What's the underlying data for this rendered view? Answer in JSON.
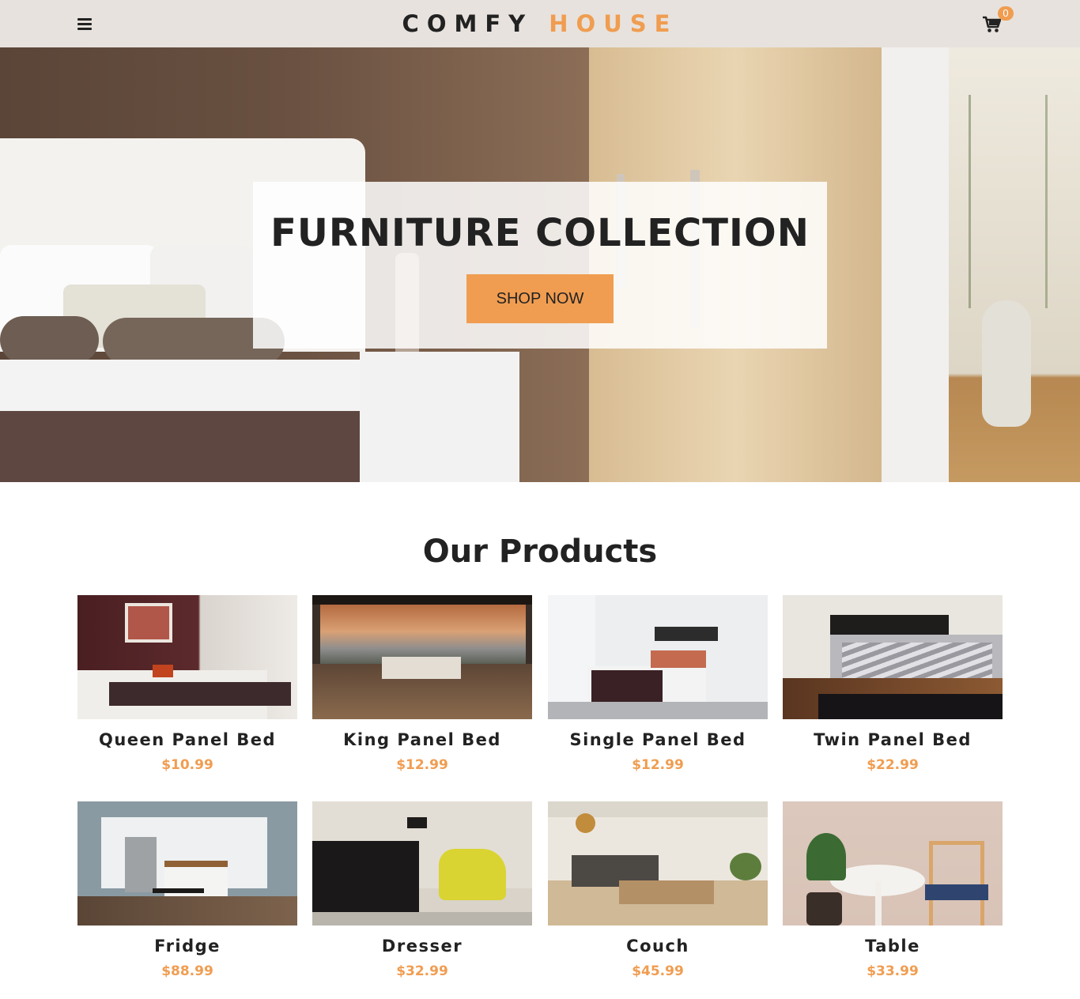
{
  "navbar": {
    "brand_first": "COMFY",
    "brand_second": "HOUSE",
    "cart_count": "0",
    "menu_icon": "bars-icon",
    "cart_icon": "cart-icon"
  },
  "hero": {
    "title": "FURNITURE COLLECTION",
    "button_label": "SHOP NOW"
  },
  "products": {
    "title": "Our Products",
    "items": [
      {
        "name": "Queen Panel Bed",
        "price": "$10.99"
      },
      {
        "name": "King Panel Bed",
        "price": "$12.99"
      },
      {
        "name": "Single Panel Bed",
        "price": "$12.99"
      },
      {
        "name": "Twin Panel Bed",
        "price": "$22.99"
      },
      {
        "name": "Fridge",
        "price": "$88.99"
      },
      {
        "name": "Dresser",
        "price": "$32.99"
      },
      {
        "name": "Couch",
        "price": "$45.99"
      },
      {
        "name": "Table",
        "price": "$33.99"
      }
    ]
  },
  "colors": {
    "accent": "#f09d51",
    "navbar_bg": "#e7e2dd",
    "text": "#222222"
  }
}
